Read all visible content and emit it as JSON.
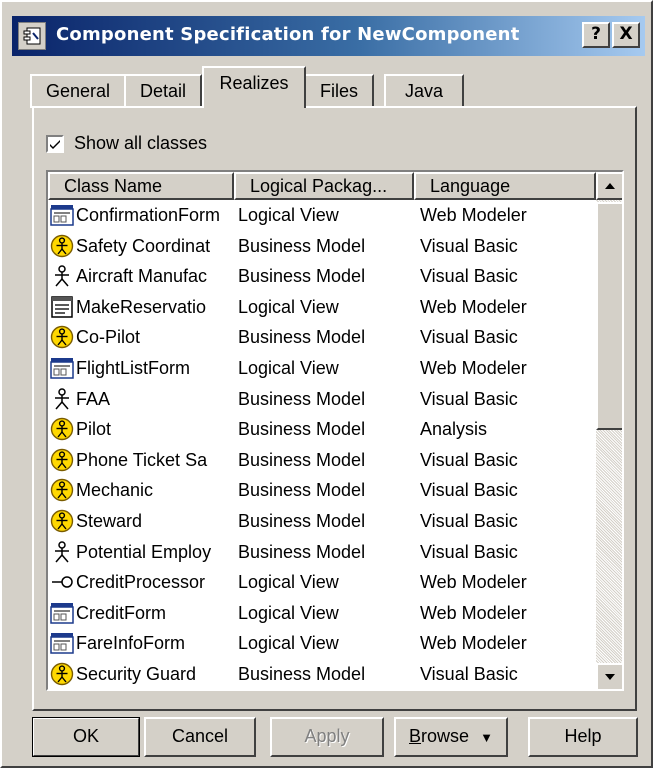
{
  "window": {
    "title": "Component Specification for NewComponent",
    "help_glyph": "?",
    "close_glyph": "X",
    "app_icon": "component-icon"
  },
  "tabs": [
    {
      "label": "General",
      "active": false
    },
    {
      "label": "Detail",
      "active": false
    },
    {
      "label": "Realizes",
      "active": true
    },
    {
      "label": "Files",
      "active": false
    },
    {
      "label": "Java",
      "active": false
    }
  ],
  "show_all_classes": {
    "label": "Show all classes",
    "checked": true
  },
  "list": {
    "columns": [
      "Class Name",
      "Logical Packag...",
      "Language"
    ],
    "rows": [
      {
        "icon": "form-class-icon",
        "name": "ConfirmationForm",
        "package": "Logical View",
        "language": "Web Modeler"
      },
      {
        "icon": "business-worker-icon",
        "name": "Safety Coordinat",
        "package": "Business Model",
        "language": "Visual Basic"
      },
      {
        "icon": "actor-icon",
        "name": "Aircraft Manufac",
        "package": "Business Model",
        "language": "Visual Basic"
      },
      {
        "icon": "page-class-icon",
        "name": "MakeReservatio",
        "package": "Logical View",
        "language": "Web Modeler"
      },
      {
        "icon": "business-worker-icon",
        "name": "Co-Pilot",
        "package": "Business Model",
        "language": "Visual Basic"
      },
      {
        "icon": "form-class-icon",
        "name": "FlightListForm",
        "package": "Logical View",
        "language": "Web Modeler"
      },
      {
        "icon": "actor-icon",
        "name": "FAA",
        "package": "Business Model",
        "language": "Visual Basic"
      },
      {
        "icon": "business-worker-icon",
        "name": "Pilot",
        "package": "Business Model",
        "language": "Analysis"
      },
      {
        "icon": "business-worker-icon",
        "name": "Phone Ticket Sa",
        "package": "Business Model",
        "language": "Visual Basic"
      },
      {
        "icon": "business-worker-icon",
        "name": "Mechanic",
        "package": "Business Model",
        "language": "Visual Basic"
      },
      {
        "icon": "business-worker-icon",
        "name": "Steward",
        "package": "Business Model",
        "language": "Visual Basic"
      },
      {
        "icon": "actor-icon",
        "name": "Potential Employ",
        "package": "Business Model",
        "language": "Visual Basic"
      },
      {
        "icon": "interface-icon",
        "name": "CreditProcessor",
        "package": "Logical View",
        "language": "Web Modeler"
      },
      {
        "icon": "form-class-icon",
        "name": "CreditForm",
        "package": "Logical View",
        "language": "Web Modeler"
      },
      {
        "icon": "form-class-icon",
        "name": "FareInfoForm",
        "package": "Logical View",
        "language": "Web Modeler"
      },
      {
        "icon": "business-worker-icon",
        "name": "Security Guard",
        "package": "Business Model",
        "language": "Visual Basic"
      }
    ]
  },
  "buttons": {
    "ok": "OK",
    "cancel": "Cancel",
    "apply": "Apply",
    "browse": "Browse",
    "browse_mnemonic": "B",
    "browse_rest": "rowse",
    "browse_arrow": "▼",
    "help": "Help"
  }
}
